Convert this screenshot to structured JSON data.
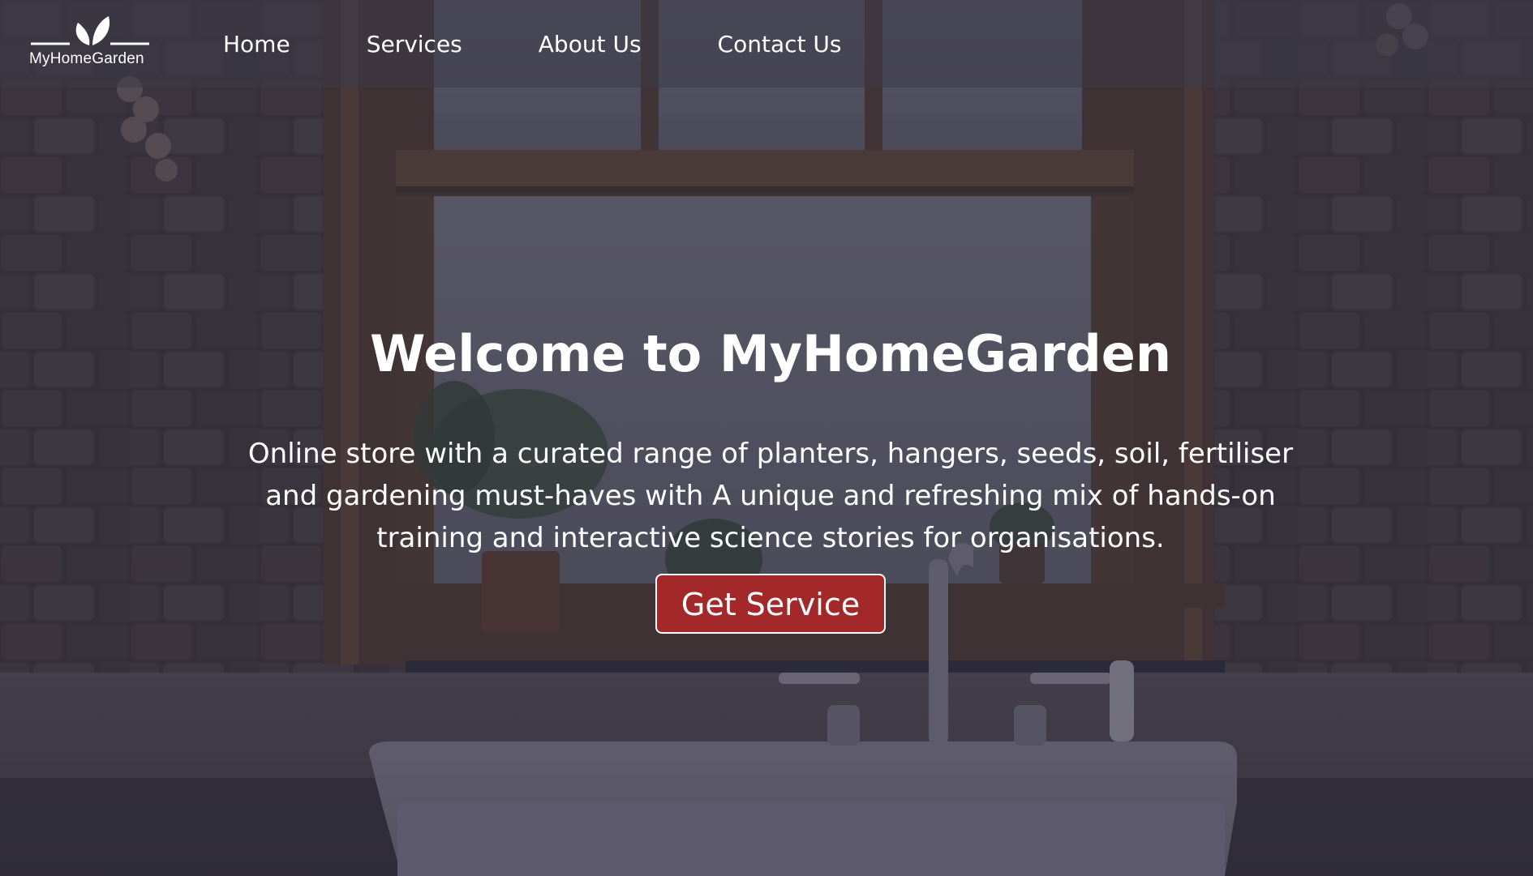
{
  "brand": {
    "name": "MyHomeGarden",
    "logo_icon": "leaf-icon"
  },
  "nav": {
    "items": [
      {
        "label": "Home"
      },
      {
        "label": "Services"
      },
      {
        "label": "About Us"
      },
      {
        "label": "Contact Us"
      }
    ]
  },
  "hero": {
    "title": "Welcome to MyHomeGarden",
    "description": "Online store with a curated range of planters, hangers, seeds, soil, fertiliser and gardening must-haves with A unique and refreshing mix of hands-on training and interactive science stories for organisations.",
    "cta_label": "Get Service"
  },
  "colors": {
    "cta_background": "#a3282a",
    "nav_overlay": "rgba(60,58,72,0.55)",
    "text": "#ffffff"
  }
}
